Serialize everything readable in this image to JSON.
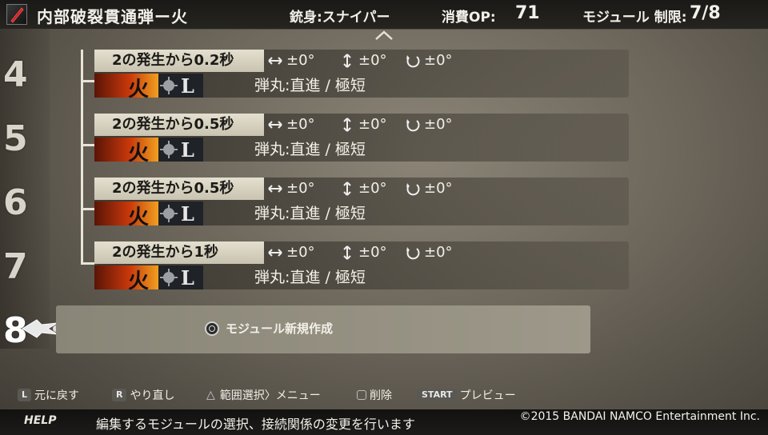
{
  "header": {
    "title": "内部破裂貫通弾ー火",
    "gun_label": "銃身:スナイパー",
    "op_label": "消費OP:",
    "op_value": "71",
    "limit_label": "モジュール 制限:",
    "limit_value": "7/8"
  },
  "row_numbers": [
    "4",
    "5",
    "6",
    "7",
    "8"
  ],
  "modules": [
    {
      "trigger": "2の発生から0.2秒",
      "h_angle": "±0°",
      "v_angle": "±0°",
      "rot_angle": "±0°",
      "element": "火",
      "range": "L",
      "description": "弾丸:直進 / 極短"
    },
    {
      "trigger": "2の発生から0.5秒",
      "h_angle": "±0°",
      "v_angle": "±0°",
      "rot_angle": "±0°",
      "element": "火",
      "range": "L",
      "description": "弾丸:直進 / 極短"
    },
    {
      "trigger": "2の発生から0.5秒",
      "h_angle": "±0°",
      "v_angle": "±0°",
      "rot_angle": "±0°",
      "element": "火",
      "range": "L",
      "description": "弾丸:直進 / 極短"
    },
    {
      "trigger": "2の発生から1秒",
      "h_angle": "±0°",
      "v_angle": "±0°",
      "rot_angle": "±0°",
      "element": "火",
      "range": "L",
      "description": "弾丸:直進 / 極短"
    }
  ],
  "new_module": {
    "label": "モジュール新規作成"
  },
  "button_bar": {
    "undo": {
      "key": "L",
      "label": "元に戻す"
    },
    "redo": {
      "key": "R",
      "label": "やり直し"
    },
    "range_menu": {
      "key": "△",
      "label": "範囲選択〉メニュー"
    },
    "delete": {
      "key": "",
      "label": "削除"
    },
    "preview": {
      "key": "START",
      "label": "プレビュー"
    }
  },
  "help": {
    "label": "HELP",
    "text": "編集するモジュールの選択、接続関係の変更を行います"
  },
  "copyright": "©2015 BANDAI NAMCO Entertainment Inc.",
  "colors": {
    "element_fire": "#c8380a",
    "label_bg": "#e4e0cf"
  }
}
